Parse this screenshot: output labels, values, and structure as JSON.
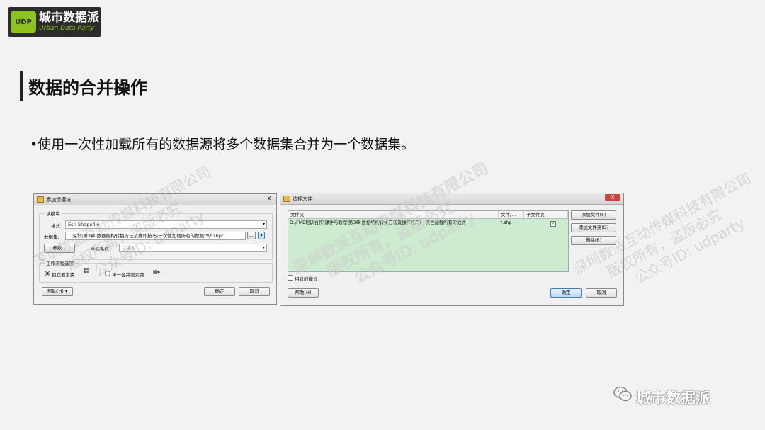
{
  "logo": {
    "mark": "UDP",
    "name_cn": "城市数据派",
    "name_en": "Urban Data Party"
  },
  "page_title": "数据的合并操作",
  "bullet": "•使用一次性加载所有的数据源将多个数据集合并为一个数据集。",
  "watermarks": {
    "company": "深圳数派互动传媒科技有限公司",
    "rights": "版权所有，盗版必究",
    "account": "公众号ID: udparty"
  },
  "dialog_left": {
    "title": "添加读模块",
    "close": "X",
    "reader_group": "读模块",
    "format_label": "格式:",
    "format_value": "Esri Shapefile",
    "dataset_label": "数据集:",
    "dataset_value": "...深圳\\第3章 数据结构转换方法及操作技巧\\一次性加载所有的数据\\*\\*.shp\"",
    "browse": "...",
    "params_button": "参数...",
    "coord_label": "坐标系统:",
    "coord_value": "以读入",
    "workflow_group": "工作流程选项",
    "option_individual": "独立要素类",
    "option_single": "单一合并要素类",
    "help": "帮助(H) ▾",
    "ok": "确定",
    "cancel": "取消"
  },
  "dialog_right": {
    "title": "选择文件",
    "close": "X",
    "columns": [
      "文件夹",
      "文件/...",
      "子文件夹"
    ],
    "row": {
      "folder": "D:\\FME培训合作\\课件与教程\\第3章 数据结构转换方法及操作技巧\\一次性加载所有的数据",
      "file": "*.shp",
      "subfolder": "✓"
    },
    "add_file": "添加文件(F)",
    "add_folder": "添加文件夹(D)",
    "delete": "删除(R)",
    "relative_mode": "相对的模式",
    "help": "帮助(H)",
    "ok": "确定",
    "cancel": "取消"
  },
  "footer_brand": "城市数据派",
  "colors": {
    "logo_green": "#8dc21f",
    "table_green": "#cdebcf"
  }
}
